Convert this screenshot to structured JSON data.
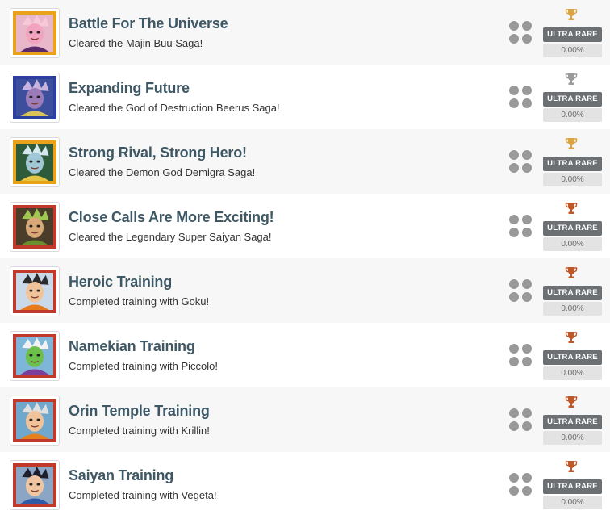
{
  "achievements": [
    {
      "title": "Battle For The Universe",
      "description": "Cleared the Majin Buu Saga!",
      "rarity": "ULTRA RARE",
      "percent": "0.00%",
      "trophy": "gold",
      "badge": "majin-buu",
      "frame": "orange"
    },
    {
      "title": "Expanding Future",
      "description": "Cleared the God of Destruction Beerus Saga!",
      "rarity": "ULTRA RARE",
      "percent": "0.00%",
      "trophy": "silver",
      "badge": "beerus",
      "frame": "blue"
    },
    {
      "title": "Strong Rival, Strong Hero!",
      "description": "Cleared the Demon God Demigra Saga!",
      "rarity": "ULTRA RARE",
      "percent": "0.00%",
      "trophy": "gold",
      "badge": "demigra",
      "frame": "orange"
    },
    {
      "title": "Close Calls Are More Exciting!",
      "description": "Cleared the Legendary Super Saiyan Saga!",
      "rarity": "ULTRA RARE",
      "percent": "0.00%",
      "trophy": "bronze",
      "badge": "broly",
      "frame": "red"
    },
    {
      "title": "Heroic Training",
      "description": "Completed training with Goku!",
      "rarity": "ULTRA RARE",
      "percent": "0.00%",
      "trophy": "bronze",
      "badge": "goku",
      "frame": "red"
    },
    {
      "title": "Namekian Training",
      "description": "Completed training with Piccolo!",
      "rarity": "ULTRA RARE",
      "percent": "0.00%",
      "trophy": "bronze",
      "badge": "piccolo",
      "frame": "red"
    },
    {
      "title": "Orin Temple Training",
      "description": "Completed training with Krillin!",
      "rarity": "ULTRA RARE",
      "percent": "0.00%",
      "trophy": "bronze",
      "badge": "krillin",
      "frame": "red"
    },
    {
      "title": "Saiyan Training",
      "description": "Completed training with Vegeta!",
      "rarity": "ULTRA RARE",
      "percent": "0.00%",
      "trophy": "bronze",
      "badge": "vegeta",
      "frame": "red"
    }
  ],
  "colors": {
    "gold": "#d9a441",
    "silver": "#9a9a9a",
    "bronze": "#c0572b",
    "frame_orange": "#e8a31a",
    "frame_blue": "#2c3e9e",
    "frame_red": "#c0392b",
    "title": "#3f5866",
    "rarity_bg": "#6d7073"
  }
}
